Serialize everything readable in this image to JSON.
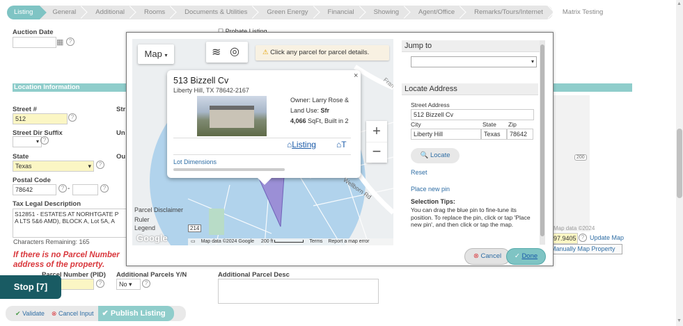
{
  "tabs": [
    "Listing",
    "General",
    "Additional",
    "Rooms",
    "Documents & Utilities",
    "Green Energy",
    "Financial",
    "Showing",
    "Agent/Office",
    "Remarks/Tours/Internet",
    "Matrix Testing"
  ],
  "form": {
    "auction_date_label": "Auction Date",
    "probate_label": "Probate Listing",
    "section_title": "Location Information",
    "street_num_label": "Street #",
    "street_num_value": "512",
    "street_dir_label": "Street Dir Suffix",
    "state_label": "State",
    "state_value": "Texas",
    "postal_label": "Postal Code",
    "postal_value": "78642",
    "postal_ext": "-",
    "tax_legal_label": "Tax Legal Description",
    "tax_legal_value": "S12851 - ESTATES AT NORHTGATE P\nA LTS 5&6 AMD), BLOCK A, Lot 5A, A",
    "chars_remaining": "Characters Remaining: 165",
    "warning_line1": "If there is no Parcel Number",
    "warning_line2": "address of the property.",
    "parcel_label": "Parcel Number (PID)",
    "additional_parcels_label": "Additional Parcels Y/N",
    "additional_parcels_value": "No",
    "additional_desc_label": "Additional Parcel Desc",
    "map_data_right": "Map data ©2024",
    "coord_value": "97.9405",
    "update_map": "Update Map",
    "manually_map": "Manually Map Property",
    "partial_str": "Str",
    "partial_un": "Un",
    "partial_ou": "Ou"
  },
  "dialog": {
    "map_button": "Map",
    "hint": "Click any parcel for parcel details.",
    "popup": {
      "title": "513 Bizzell Cv",
      "subtitle": "Liberty Hill, TX 78642-2167",
      "owner": "Owner: Larry Rose &",
      "land_use_label": "Land Use: ",
      "land_use_value": "Sfr",
      "sqft": "4,066",
      "sqft_suffix": " SqFt, Built in 2",
      "listing_link": "Listing",
      "lot_dimensions": "Lot Dimensions"
    },
    "map_labels": {
      "parcel_disclaimer": "Parcel Disclaimer",
      "ruler": "Ruler",
      "legend": "Legend",
      "road_badge": "214",
      "street_franc": "Fran",
      "street_wellborn": "Wellborn Rd",
      "google": "Google",
      "map_data": "Map data ©2024 Google",
      "scale": "200 ft",
      "terms": "Terms",
      "report": "Report a map error"
    },
    "side": {
      "jump_to": "Jump to",
      "locate_address": "Locate Address",
      "street_address_label": "Street Address",
      "street_address_value": "512 Bizzell Cv",
      "city_label": "City",
      "city_value": "Liberty Hill",
      "state_label": "State",
      "state_value": "Texas",
      "zip_label": "Zip",
      "zip_value": "78642",
      "locate_btn": "Locate",
      "reset": "Reset",
      "place_pin": "Place new pin",
      "tips_title": "Selection Tips:",
      "tips_text": "You can drag the blue pin to fine-tune its position. To replace the pin, click or tap 'Place new pin', and then click or tap the map."
    },
    "cancel": "Cancel",
    "done": "Done"
  },
  "stop_label": "Stop [7]",
  "bottom": {
    "validate": "Validate",
    "cancel_input": "Cancel Input",
    "publish": "Publish Listing"
  },
  "colors": {
    "teal": "#7fc4c4",
    "dark_teal": "#195b63",
    "link": "#2e6da4",
    "yellow_field": "#fbf6c4"
  }
}
